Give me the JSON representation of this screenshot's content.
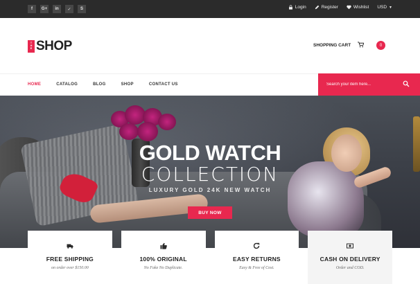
{
  "topbar": {
    "social": [
      {
        "name": "facebook-icon",
        "glyph": "f"
      },
      {
        "name": "google-plus-icon",
        "glyph": "G+"
      },
      {
        "name": "linkedin-icon",
        "glyph": "in"
      },
      {
        "name": "twitter-icon",
        "glyph": "✓"
      },
      {
        "name": "skype-icon",
        "glyph": "S"
      }
    ],
    "login": "Login",
    "register": "Register",
    "wishlist": "Wishlist",
    "currency": "USD"
  },
  "header": {
    "logo_badge": [
      "T",
      "H",
      "E"
    ],
    "logo_text": "SHOP",
    "cart_label": "SHOPPING CART",
    "cart_count": "0"
  },
  "nav": {
    "items": [
      "HOME",
      "CATALOG",
      "BLOG",
      "SHOP",
      "CONTACT US"
    ],
    "search_placeholder": "Search your item here..."
  },
  "hero": {
    "title": "GOLD WATCH",
    "subtitle": "COLLECTION",
    "tagline": "LUXURY GOLD 24K NEW WATCH",
    "button": "BUY NOW"
  },
  "features": [
    {
      "icon": "truck-icon",
      "title": "FREE SHIPPING",
      "subtitle": "on order over $150.00"
    },
    {
      "icon": "thumbs-up-icon",
      "title": "100% ORIGINAL",
      "subtitle": "No Fake No Duplicate."
    },
    {
      "icon": "refresh-icon",
      "title": "EASY RETURNS",
      "subtitle": "Easy & Free of Cost."
    },
    {
      "icon": "money-icon",
      "title": "CASH ON DELIVERY",
      "subtitle": "Order and COD."
    }
  ],
  "colors": {
    "accent": "#e8284f",
    "topbar": "#2b2b2b"
  }
}
